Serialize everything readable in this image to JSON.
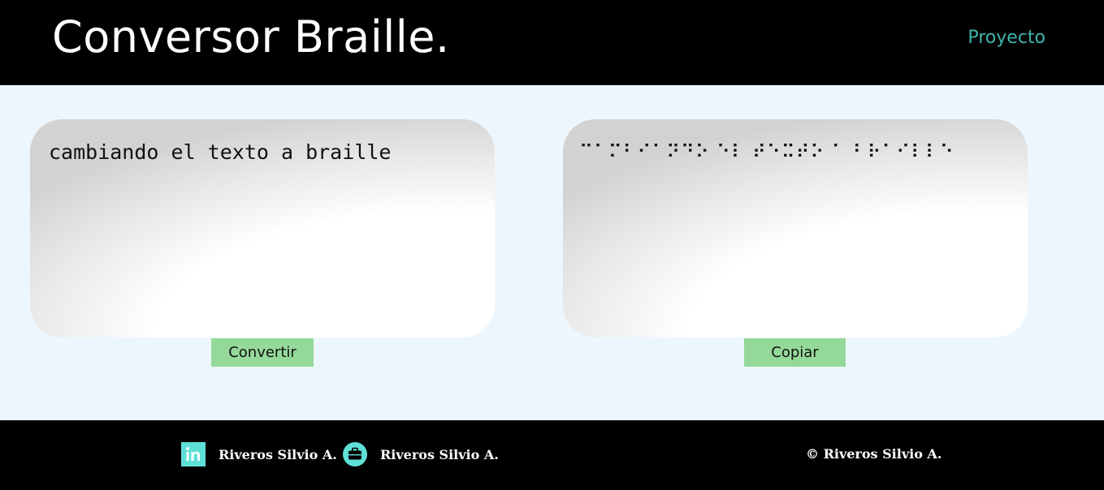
{
  "header": {
    "title": "Conversor Braille.",
    "nav_link": "Proyecto"
  },
  "input_panel": {
    "value": "cambiando el texto a braille",
    "button_label": "Convertir"
  },
  "output_panel": {
    "value": "⠉⠁⠍⠃⠊⠁⠝⠙⠕ ⠑⠇ ⠞⠑⠭⠞⠕ ⠁ ⠃⠗⠁⠊⠇⠇⠑",
    "button_label": "Copiar"
  },
  "footer": {
    "linkedin": {
      "icon": "linkedin-icon",
      "label": "Riveros Silvio A."
    },
    "portfolio": {
      "icon": "briefcase-icon",
      "label": "Riveros Silvio A."
    },
    "copyright": "© Riveros Silvio A."
  },
  "colors": {
    "header_bg": "#000000",
    "nav_link": "#3fb4ad",
    "page_bg": "#eef6fd",
    "button_bg": "#95d99a",
    "footer_icon": "#5fe0d7"
  }
}
